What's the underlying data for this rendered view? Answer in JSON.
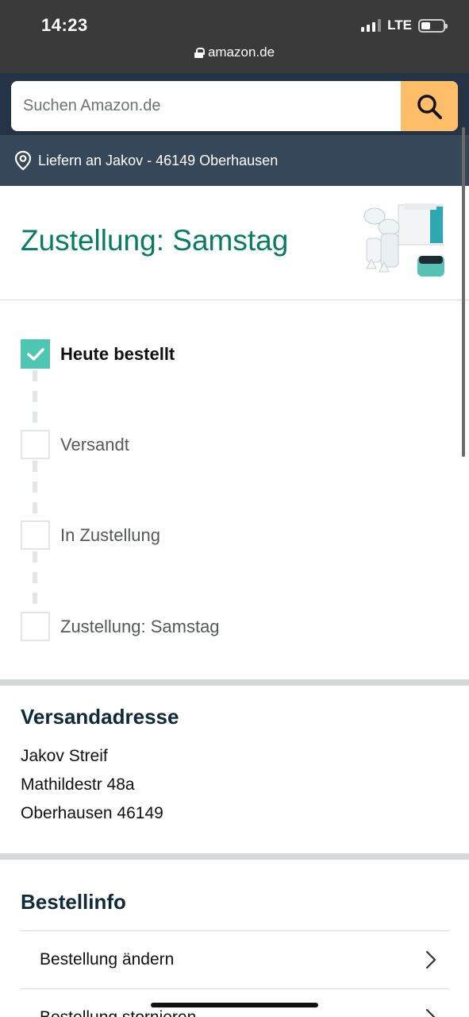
{
  "status_bar": {
    "time": "14:23",
    "network": "LTE"
  },
  "browser": {
    "url": "amazon.de"
  },
  "search": {
    "placeholder": "Suchen Amazon.de"
  },
  "deliver_to": {
    "text": "Liefern an Jakov - 46149 Oberhausen"
  },
  "shipment": {
    "title": "Zustellung: Samstag",
    "steps": [
      {
        "label": "Heute bestellt",
        "done": true
      },
      {
        "label": "Versandt",
        "done": false
      },
      {
        "label": "In Zustellung",
        "done": false
      },
      {
        "label": "Zustellung: Samstag",
        "done": false
      }
    ]
  },
  "address": {
    "title": "Versandadresse",
    "name": "Jakov Streif",
    "street": "Mathildestr 48a",
    "city": "Oberhausen 46149"
  },
  "order_info": {
    "title": "Bestellinfo",
    "items": [
      {
        "label": "Bestellung ändern"
      },
      {
        "label": "Bestellung stornieren"
      }
    ]
  },
  "colors": {
    "accent_green": "#067d62",
    "check_teal": "#4ec6b2",
    "header_dark": "#243446",
    "deliver_bar": "#37475a",
    "search_button": "#febd69"
  }
}
